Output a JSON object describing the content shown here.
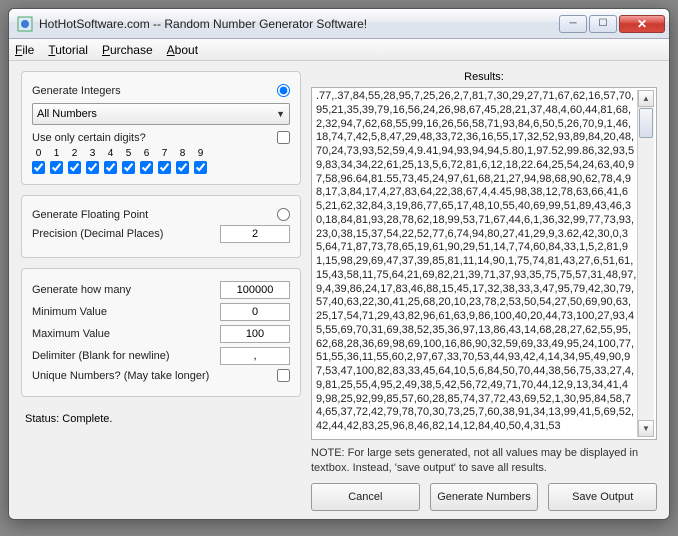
{
  "window": {
    "title": "HotHotSoftware.com -- Random Number Generator Software!"
  },
  "menu": {
    "file": "File",
    "tutorial": "Tutorial",
    "purchase": "Purchase",
    "about": "About"
  },
  "integers": {
    "heading": "Generate Integers",
    "combo_selected": "All Numbers",
    "use_digits_label": "Use only certain digits?",
    "digits": [
      "0",
      "1",
      "2",
      "3",
      "4",
      "5",
      "6",
      "7",
      "8",
      "9"
    ]
  },
  "floating": {
    "heading": "Generate Floating Point",
    "precision_label": "Precision (Decimal Places)",
    "precision_value": "2"
  },
  "params": {
    "how_many_label": "Generate how many",
    "how_many_value": "100000",
    "min_label": "Minimum Value",
    "min_value": "0",
    "max_label": "Maximum Value",
    "max_value": "100",
    "delimiter_label": "Delimiter (Blank for newline)",
    "delimiter_value": ",",
    "unique_label": "Unique Numbers? (May take longer)"
  },
  "status": "Status: Complete.",
  "results": {
    "heading": "Results:",
    "text": ".77,.37,84,55,28,95,7,25,26,2,7,81,7,30,29,27,71,67,62,16,57,70,95,21,35,39,79,16,56,24,26,98,67,45,28,21,37,48,4,60,44,81,68,2,32,94,7,62,68,55,99,16,26,56,58,71,93,84,6,50,5,26,70,9,1,46,18,74,7,42,5,8,47,29,48,33,72,36,16,55,17,32,52,93,89,84,20,48,70,24,73,93,52,59,4,9.41,94,93,94,94,5.80,1,97.52,99.86,32,93,59,83,34,34,22,61,25,13,5,6,72,81,6,12,18,22.64,25,54,24,63,40,97,58,96.64,81.55,73,45,24,97,61,68,21,27,94,98,68,90,62,78,4,98,17,3,84,17,4,27,83,64,22,38,67,4,4.45,98,38,12,78,63,66,41,65,21,62,32,84,3,19,86,77,65,17,48,10,55,40,69,99,51,89,43,46,30,18,84,81,93,28,78,62,18,99,53,71,67,44,6,1,36,32,99,77,73,93,23,0,38,15,37,54,22,52,77,6,74,94,80,27,41,29,9,3.62,42,30,0,35,64,71,87,73,78,65,19,61,90,29,51,14,7,74,60,84,33,1,5,2,81,91,15,98,29,69,47,37,39,85,81,11,14,90,1,75,74,81,43,27,6,51,61,15,43,58,11,75,64,21,69,82,21,39,71,37,93,35,75,75,57,31,48,97,9,4,39,86,24,17,83,46,88,15,45,17,32,38,33,3,47,95,79,42,30,79,57,40,63,22,30,41,25,68,20,10,23,78,2,53,50,54,27,50,69,90,63,25,17,54,71,29,43,82,96,61,63,9,86,100,40,20,44,73,100,27,93,45,55,69,70,31,69,38,52,35,36,97,13,86,43,14,68,28,27,62,55,95,62,68,28,36,69,98,69,100,16,86,90,32,59,69,33,49,95,24,100,77,51,55,36,11,55,60,2,97,67,33,70,53,44,93,42,4,14,34,95,49,90,97,53,47,100,82,83,33,45,64,10,5,6,84,50,70,44,38,56,75,33,27,4,9,81,25,55,4,95,2,49,38,5,42,56,72,49,71,70,44,12,9,13,34,41,49,98,25,92,99,85,57,60,28,85,74,37,72,43,69,52,1,30,95,84,58,74,65,37,72,42,79,78,70,30,73,25,7,60,38,91,34,13,99,41,5,69,52,42,44,42,83,25,96,8,46,82,14,12,84,40,50,4,31,53",
    "note": "NOTE: For large sets generated, not all values may be displayed in textbox. Instead, 'save output' to save all results."
  },
  "buttons": {
    "cancel": "Cancel",
    "generate": "Generate Numbers",
    "save": "Save Output"
  }
}
